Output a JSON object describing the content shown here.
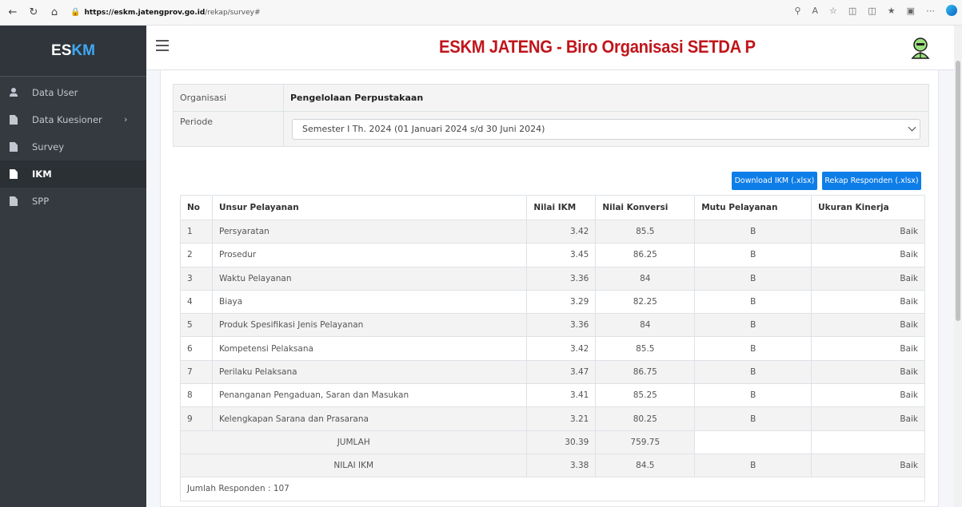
{
  "browser": {
    "url_host": "https://eskm.jatengprov.go.id",
    "url_path": "/rekap/survey#"
  },
  "sidebar": {
    "brand_prefix": "ES",
    "brand_suffix": "KM",
    "items": [
      {
        "label": "Data User",
        "icon": "user-icon"
      },
      {
        "label": "Data Kuesioner",
        "icon": "document-icon",
        "has_submenu": true
      },
      {
        "label": "Survey",
        "icon": "document-icon"
      },
      {
        "label": "IKM",
        "icon": "document-icon",
        "active": true
      },
      {
        "label": "SPP",
        "icon": "document-icon"
      }
    ]
  },
  "header": {
    "title": "ESKM JATENG - Biro Organisasi SETDA Provi"
  },
  "filter": {
    "org_label": "Organisasi",
    "org_value": "Pengelolaan Perpustakaan",
    "period_label": "Periode",
    "period_value": "Semester I Th. 2024 (01 Januari 2024 s/d 30 Juni 2024)"
  },
  "buttons": {
    "download_ikm": "Download IKM (.xlsx)",
    "rekap_responden": "Rekap Responden (.xlsx)"
  },
  "table": {
    "headers": [
      "No",
      "Unsur Pelayanan",
      "Nilai IKM",
      "Nilai Konversi",
      "Mutu Pelayanan",
      "Ukuran Kinerja"
    ],
    "rows": [
      {
        "no": "1",
        "unsur": "Persyaratan",
        "ikm": "3.42",
        "konversi": "85.5",
        "mutu": "B",
        "kinerja": "Baik"
      },
      {
        "no": "2",
        "unsur": "Prosedur",
        "ikm": "3.45",
        "konversi": "86.25",
        "mutu": "B",
        "kinerja": "Baik"
      },
      {
        "no": "3",
        "unsur": "Waktu Pelayanan",
        "ikm": "3.36",
        "konversi": "84",
        "mutu": "B",
        "kinerja": "Baik"
      },
      {
        "no": "4",
        "unsur": "Biaya",
        "ikm": "3.29",
        "konversi": "82.25",
        "mutu": "B",
        "kinerja": "Baik"
      },
      {
        "no": "5",
        "unsur": "Produk Spesifikasi Jenis Pelayanan",
        "ikm": "3.36",
        "konversi": "84",
        "mutu": "B",
        "kinerja": "Baik"
      },
      {
        "no": "6",
        "unsur": "Kompetensi Pelaksana",
        "ikm": "3.42",
        "konversi": "85.5",
        "mutu": "B",
        "kinerja": "Baik"
      },
      {
        "no": "7",
        "unsur": "Perilaku Pelaksana",
        "ikm": "3.47",
        "konversi": "86.75",
        "mutu": "B",
        "kinerja": "Baik"
      },
      {
        "no": "8",
        "unsur": "Penanganan Pengaduan, Saran dan Masukan",
        "ikm": "3.41",
        "konversi": "85.25",
        "mutu": "B",
        "kinerja": "Baik"
      },
      {
        "no": "9",
        "unsur": "Kelengkapan Sarana dan Prasarana",
        "ikm": "3.21",
        "konversi": "80.25",
        "mutu": "B",
        "kinerja": "Baik"
      }
    ],
    "jumlah": {
      "label": "JUMLAH",
      "ikm": "30.39",
      "konversi": "759.75"
    },
    "nilai": {
      "label": "NILAI IKM",
      "ikm": "3.38",
      "konversi": "84.5",
      "mutu": "B",
      "kinerja": "Baik"
    },
    "responden": "Jumlah Responden : 107"
  },
  "colors": {
    "sidebar_bg": "#343a40",
    "title_red": "#c0151b",
    "button_blue": "#0d7de8",
    "brand_accent": "#3fa9f5"
  }
}
